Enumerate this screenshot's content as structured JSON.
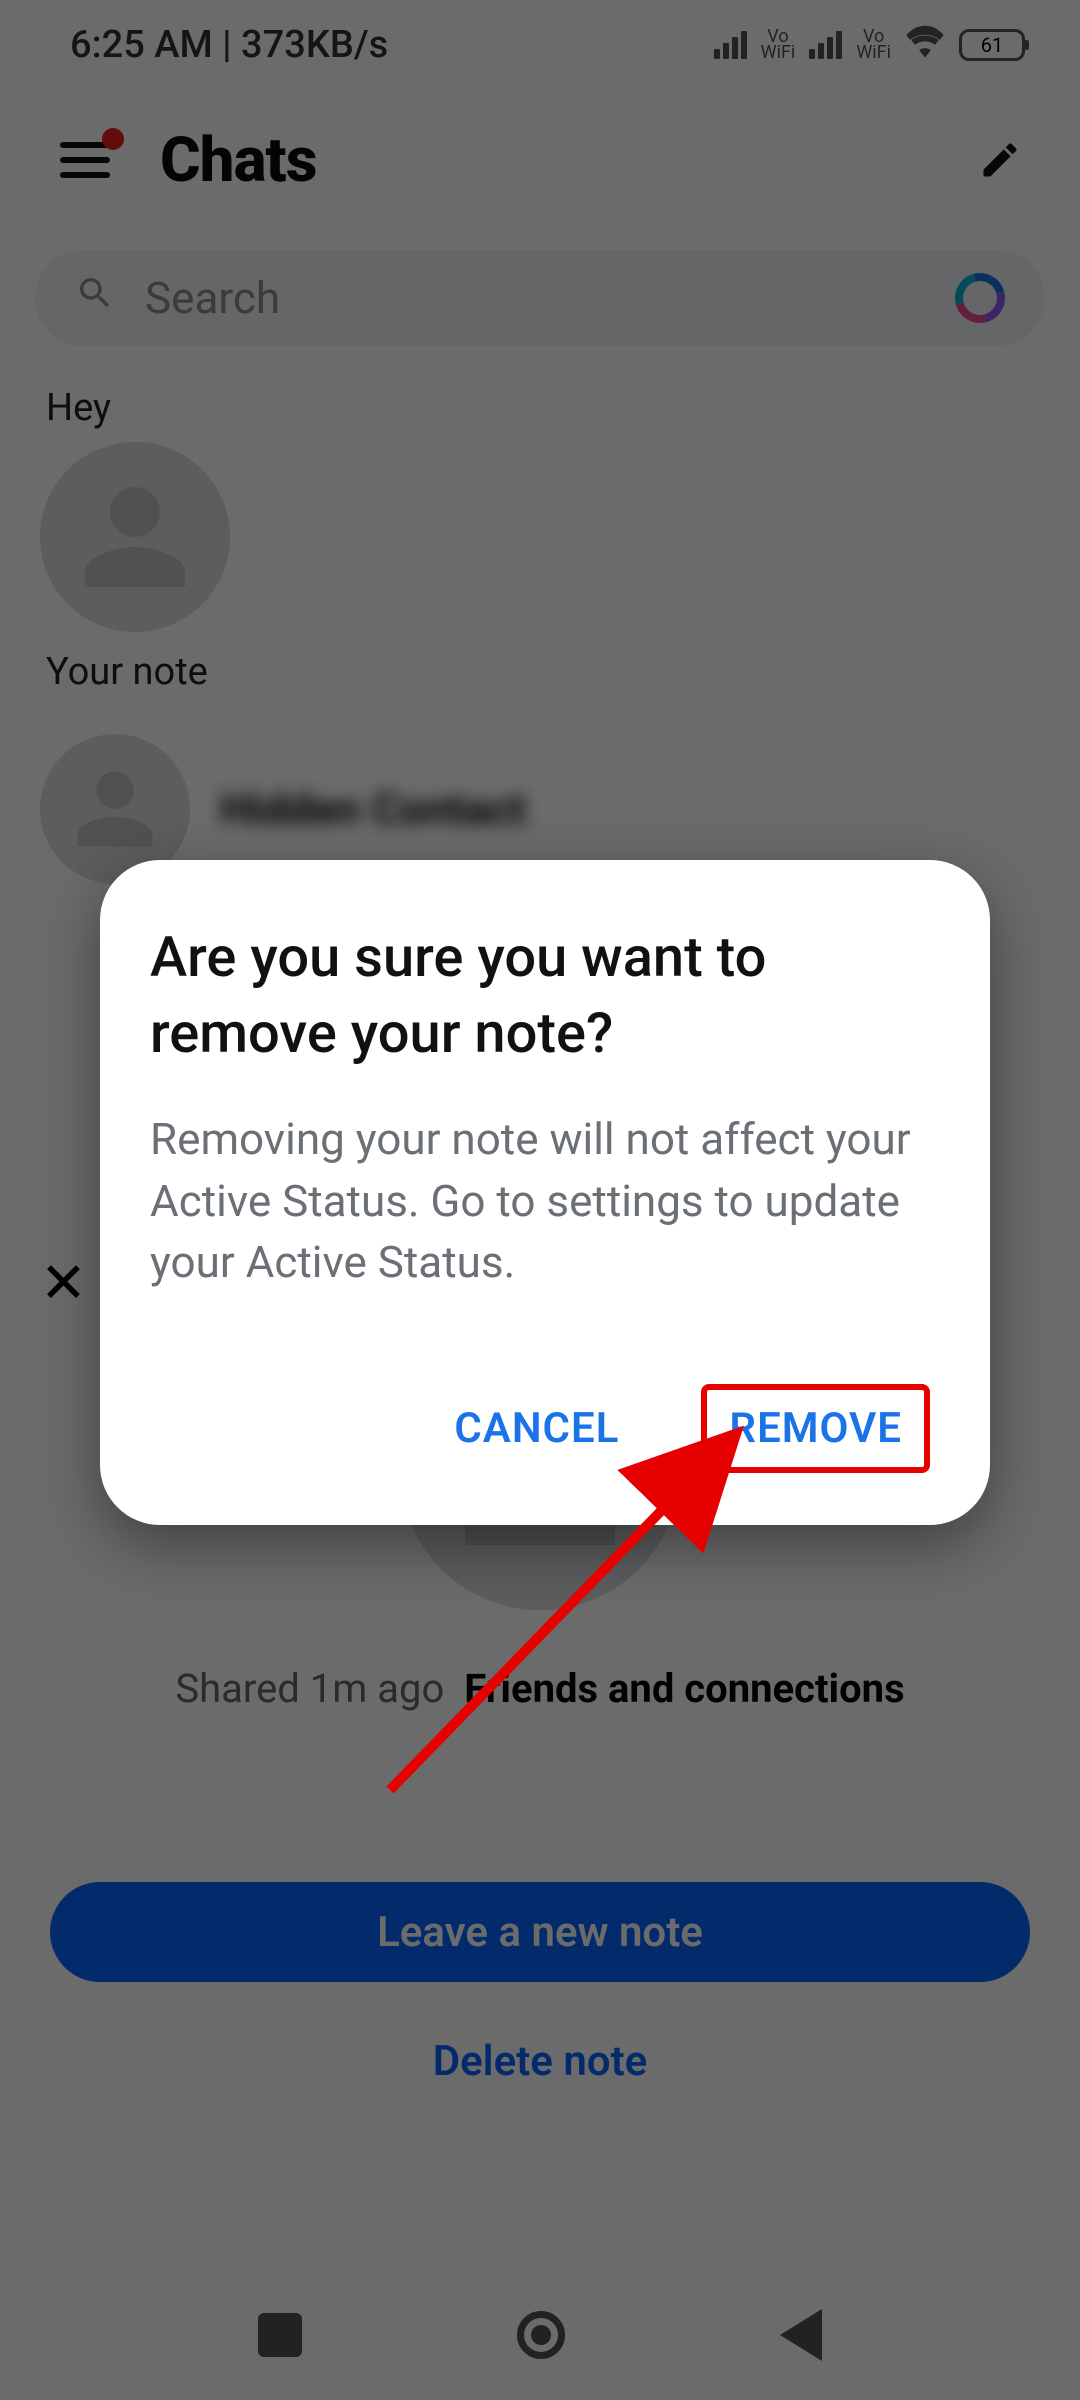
{
  "status": {
    "time": "6:25 AM",
    "net": "373KB/s",
    "battery": "61"
  },
  "header": {
    "title": "Chats"
  },
  "search": {
    "placeholder": "Search"
  },
  "notes": {
    "top_label": "Hey",
    "bottom_label": "Your note"
  },
  "note_detail": {
    "shared_time": "Shared 1m ago",
    "friends": "Friends and connections",
    "leave_btn": "Leave a new note",
    "delete": "Delete note"
  },
  "dialog": {
    "title": "Are you sure you want to remove your note?",
    "body": "Removing your note will not affect your Active Status. Go to settings to update your Active Status.",
    "cancel": "CANCEL",
    "remove": "REMOVE"
  }
}
